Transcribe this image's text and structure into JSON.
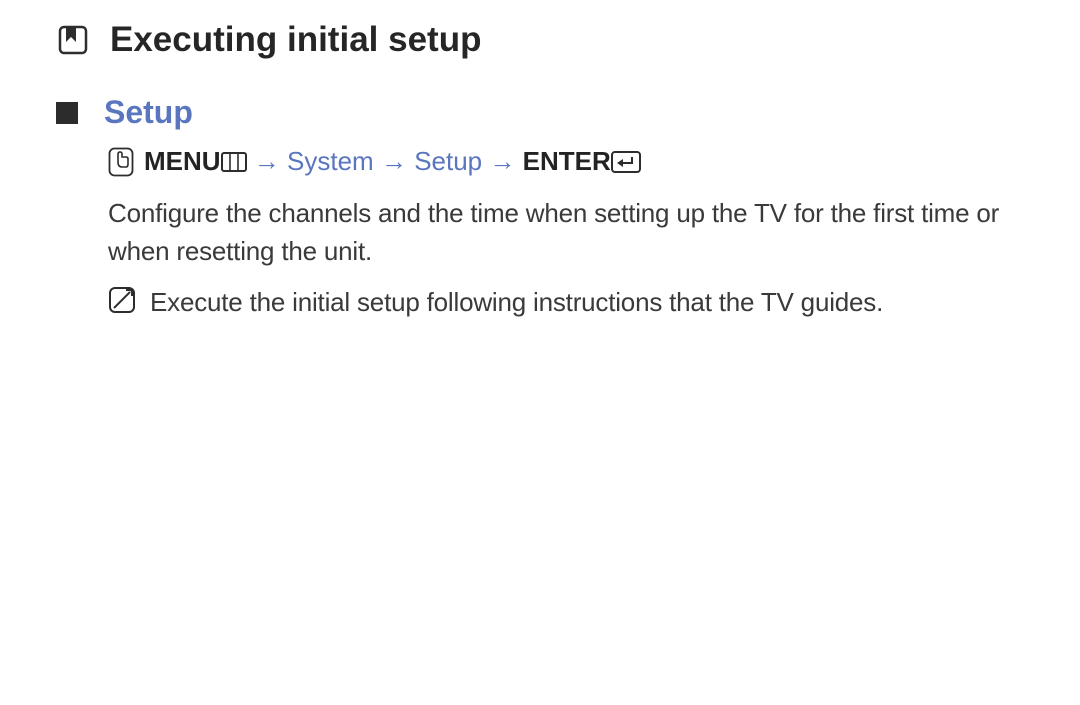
{
  "heading1": "Executing initial setup",
  "heading2": "Setup",
  "nav": {
    "menu": "MENU",
    "arrow": "→",
    "system": "System",
    "setup": "Setup",
    "enter": "ENTER"
  },
  "body": "Configure the channels and the time when setting up the TV for the first time or when resetting the unit.",
  "note": "Execute the initial setup following instructions that the TV guides."
}
